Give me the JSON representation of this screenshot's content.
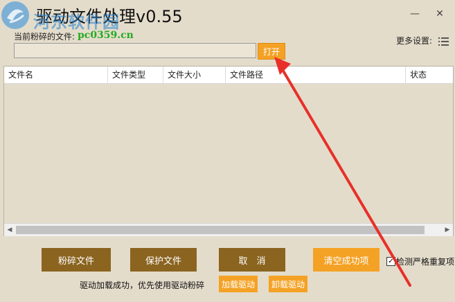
{
  "watermark": {
    "site_name": "河东软件园",
    "url": "pc0359.cn"
  },
  "window": {
    "title": "驱动文件处理v0.55",
    "minimize_glyph": "—",
    "close_glyph": "✕"
  },
  "file_section": {
    "current_file_label": "当前粉碎的文件:",
    "input_value": "",
    "open_label": "打开",
    "more_settings_label": "更多设置:"
  },
  "table": {
    "columns": [
      "文件名",
      "文件类型",
      "文件大小",
      "文件路径",
      "状态"
    ],
    "rows": []
  },
  "actions": {
    "shred_label": "粉碎文件",
    "protect_label": "保护文件",
    "cancel_label": "取　消",
    "clear_label": "清空成功项",
    "strict_check_label": "检测严格重复项",
    "strict_check_checked": true
  },
  "status": {
    "message": "驱动加载成功，优先使用驱动粉碎",
    "load_driver_label": "加载驱动",
    "unload_driver_label": "卸载驱动"
  },
  "colors": {
    "background": "#e4dccb",
    "orange_button": "#f4a225",
    "brown_button": "#8b6420",
    "annotation_arrow": "#e8302a"
  },
  "icons": {
    "settings": "list-icon",
    "logo": "watermark-logo-icon"
  }
}
